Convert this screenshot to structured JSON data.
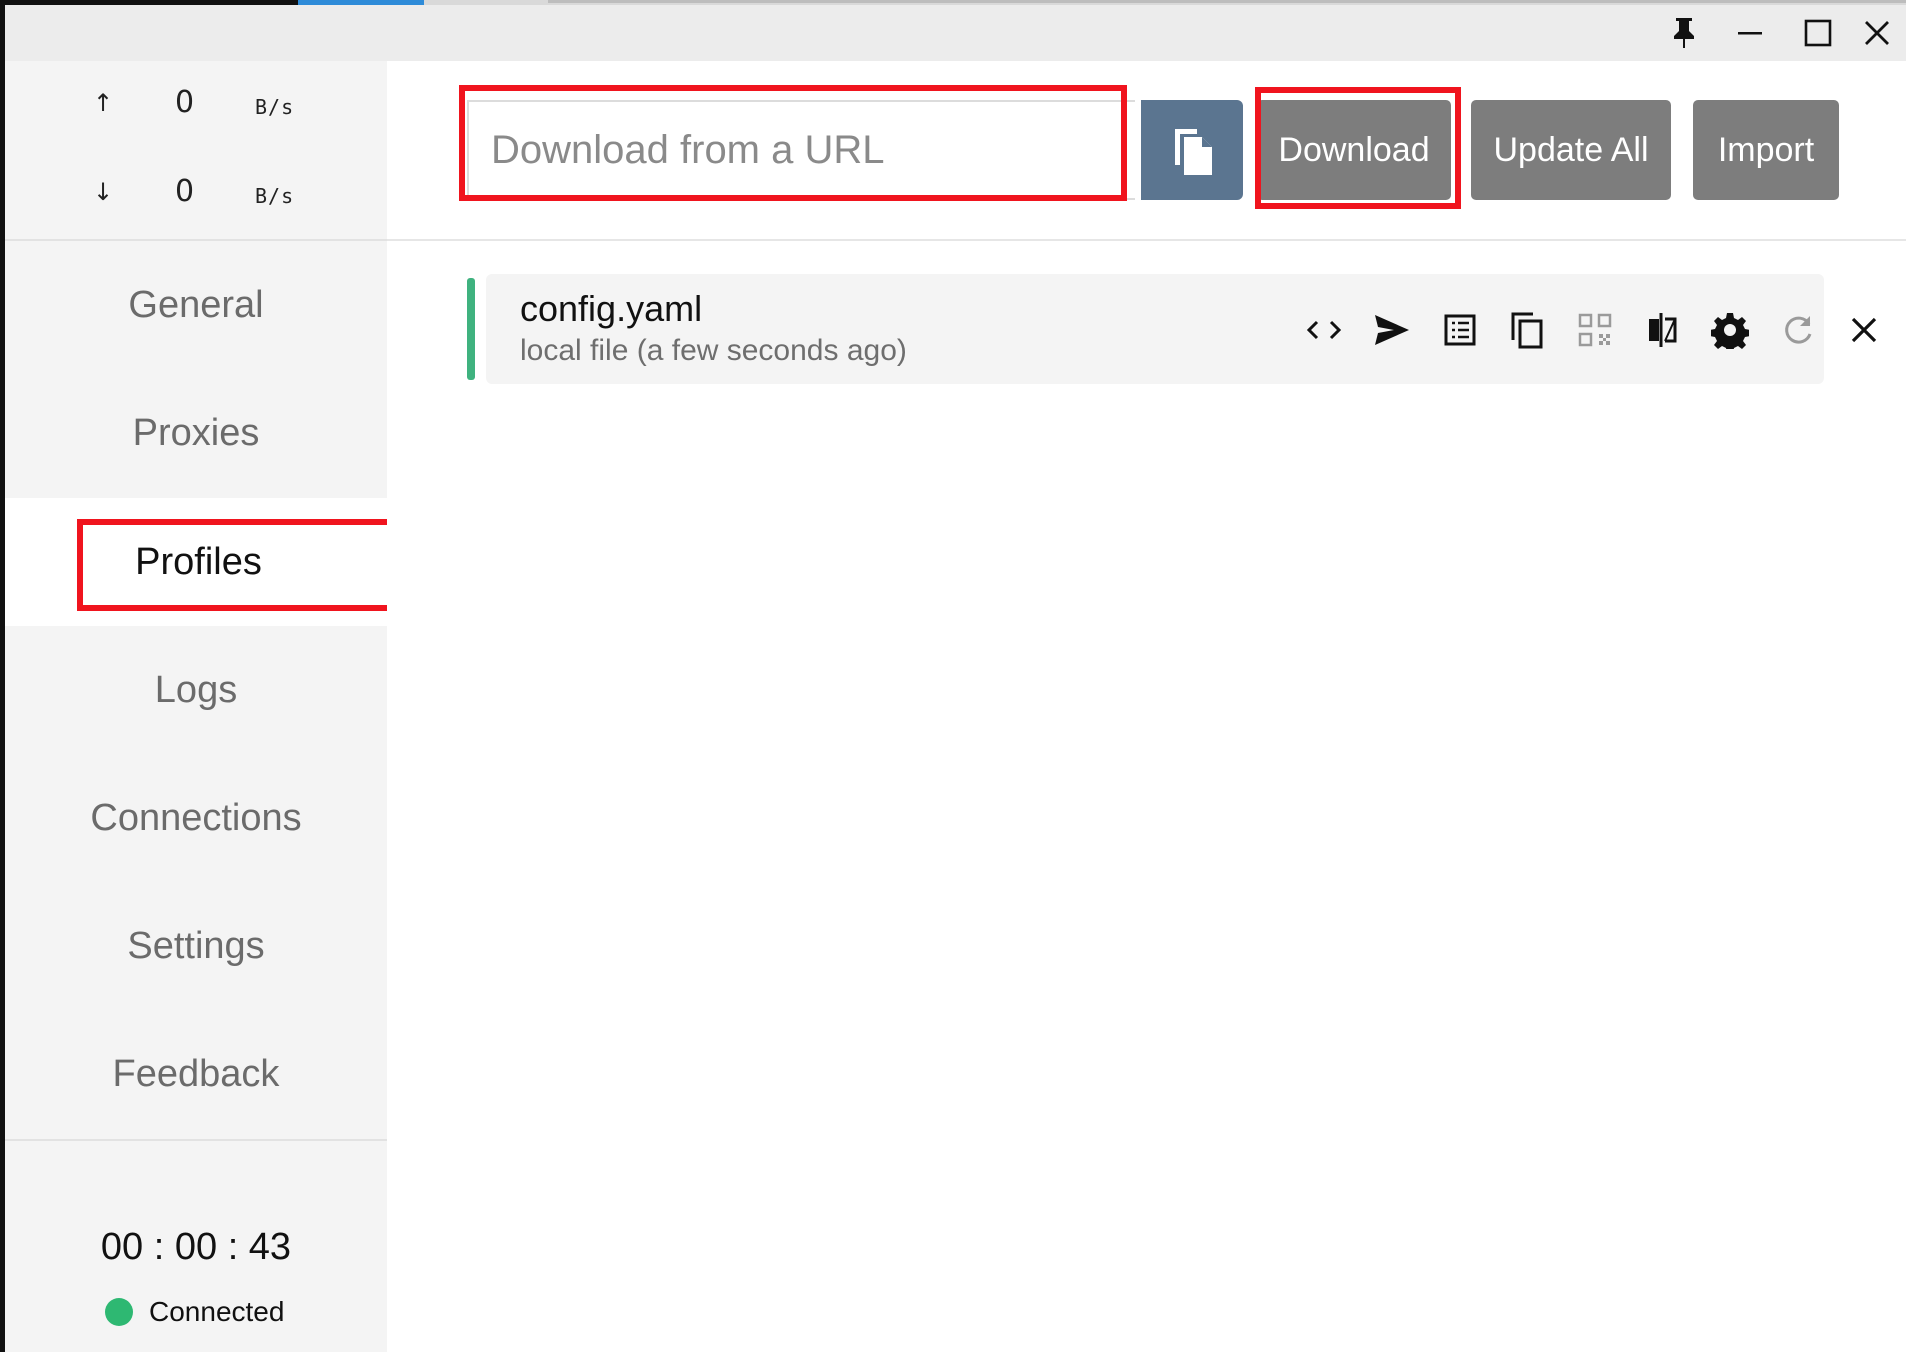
{
  "window": {
    "controls": [
      "pin-icon",
      "minimize-icon",
      "maximize-icon",
      "close-icon"
    ]
  },
  "traffic": {
    "up_arrow": "↑",
    "up_value": "0",
    "up_unit": "B/s",
    "down_arrow": "↓",
    "down_value": "0",
    "down_unit": "B/s"
  },
  "nav": {
    "items": [
      {
        "label": "General"
      },
      {
        "label": "Proxies"
      },
      {
        "label": "Profiles"
      },
      {
        "label": "Logs"
      },
      {
        "label": "Connections"
      },
      {
        "label": "Settings"
      },
      {
        "label": "Feedback"
      }
    ],
    "active": "Profiles"
  },
  "footer": {
    "uptime": "00 : 00 : 43",
    "status": "Connected",
    "status_color": "#2eb872"
  },
  "toolbar": {
    "url_placeholder": "Download from a URL",
    "url_value": "",
    "paste_icon": "paste-icon",
    "download_label": "Download",
    "update_all_label": "Update All",
    "import_label": "Import"
  },
  "profiles": [
    {
      "name": "config.yaml",
      "meta": "local file (a few seconds ago)",
      "selected": true,
      "accent_color": "#3fb27f",
      "actions": [
        "code-icon",
        "send-icon",
        "list-icon",
        "copy-icon",
        "qrcode-icon",
        "compare-icon",
        "settings-icon",
        "refresh-icon",
        "delete-icon"
      ]
    }
  ],
  "colors": {
    "highlight": "#f0141e",
    "button_gray": "#7d7d7d",
    "paste_button": "#5b7590"
  }
}
